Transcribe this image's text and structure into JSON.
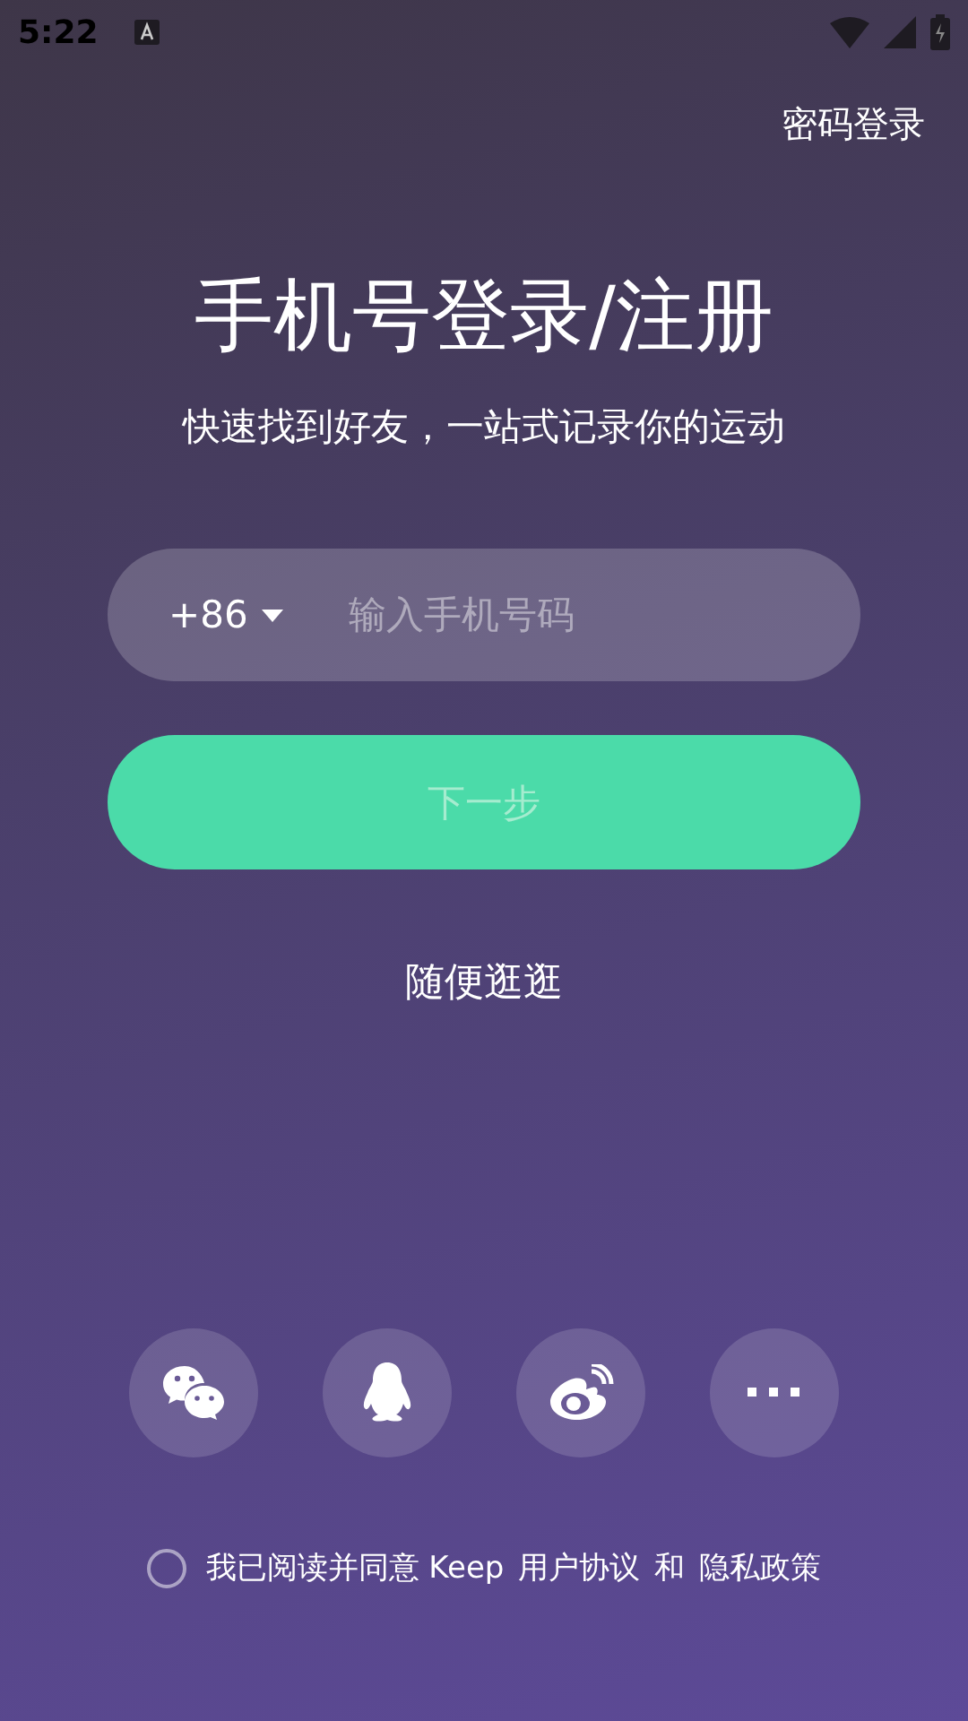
{
  "status_bar": {
    "time": "5:22"
  },
  "password_login": "密码登录",
  "title": "手机号登录/注册",
  "subtitle": "快速找到好友，一站式记录你的运动",
  "phone": {
    "country_code": "+86",
    "placeholder": "输入手机号码"
  },
  "next_button": {
    "label": "下一步",
    "disabled": true
  },
  "browse_link": "随便逛逛",
  "social_logins": [
    {
      "kind": "chat"
    },
    {
      "kind": "penguin"
    },
    {
      "kind": "eye"
    },
    {
      "kind": "more"
    }
  ],
  "agreement": {
    "checked": false,
    "prefix": "我已阅读并同意 Keep",
    "terms": "用户协议",
    "joiner": "和",
    "privacy": "隐私政策"
  }
}
